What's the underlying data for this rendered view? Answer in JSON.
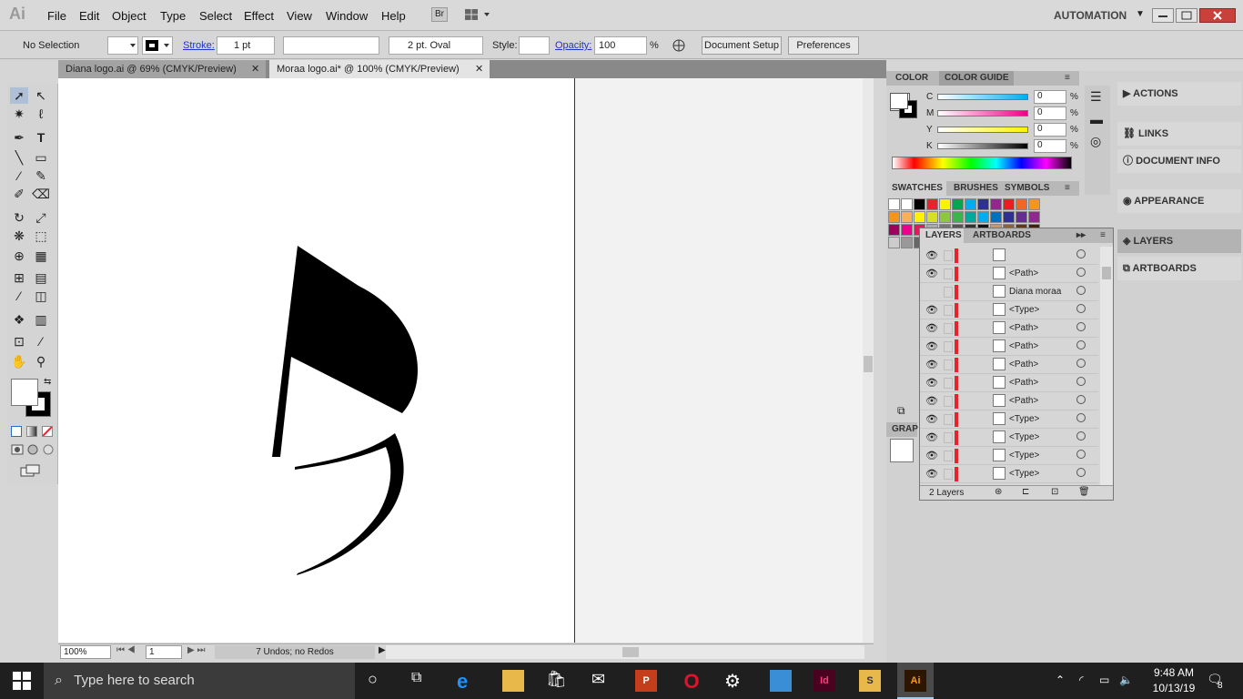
{
  "app": {
    "logo": "Ai",
    "workspace": "AUTOMATION"
  },
  "menu": [
    "File",
    "Edit",
    "Object",
    "Type",
    "Select",
    "Effect",
    "View",
    "Window",
    "Help"
  ],
  "menu_buttons": [
    "Br"
  ],
  "control": {
    "selection": "No Selection",
    "stroke_label": "Stroke:",
    "stroke_value": "1 pt",
    "brush_value": "2 pt. Oval",
    "style_label": "Style:",
    "opacity_label": "Opacity:",
    "opacity_value": "100",
    "opacity_unit": "%",
    "doc_setup": "Document Setup",
    "preferences": "Preferences"
  },
  "tabs": [
    {
      "label": "Diana logo.ai @ 69% (CMYK/Preview)"
    },
    {
      "label": "Moraa logo.ai* @ 100% (CMYK/Preview)"
    }
  ],
  "status": {
    "zoom": "100%",
    "page": "1",
    "message": "7 Undos; no Redos"
  },
  "color_panel": {
    "tabs": [
      "COLOR",
      "COLOR GUIDE"
    ],
    "channels": [
      {
        "name": "C",
        "value": "0",
        "unit": "%"
      },
      {
        "name": "M",
        "value": "0",
        "unit": "%"
      },
      {
        "name": "Y",
        "value": "0",
        "unit": "%"
      },
      {
        "name": "K",
        "value": "0",
        "unit": "%"
      }
    ]
  },
  "swatch_tabs": [
    "SWATCHES",
    "BRUSHES",
    "SYMBOLS"
  ],
  "graphic_tab": "GRAP",
  "layers_panel": {
    "tabs": [
      "LAYERS",
      "ARTBOARDS"
    ],
    "rows": [
      "",
      "<Path>",
      "Diana moraa",
      "<Type>",
      "<Path>",
      "<Path>",
      "<Path>",
      "<Path>",
      "<Path>",
      "<Type>",
      "<Type>",
      "<Type>",
      "<Type>"
    ],
    "footer": "2 Layers"
  },
  "dock": [
    "ACTIONS",
    "LINKS",
    "DOCUMENT INFO",
    "APPEARANCE",
    "LAYERS",
    "ARTBOARDS"
  ],
  "taskbar": {
    "search_placeholder": "Type here to search",
    "time": "9:48 AM",
    "date": "10/13/19",
    "notifications": "8"
  },
  "colors": {
    "accent": "#0070c0",
    "swatch_red": "#e8232a"
  }
}
